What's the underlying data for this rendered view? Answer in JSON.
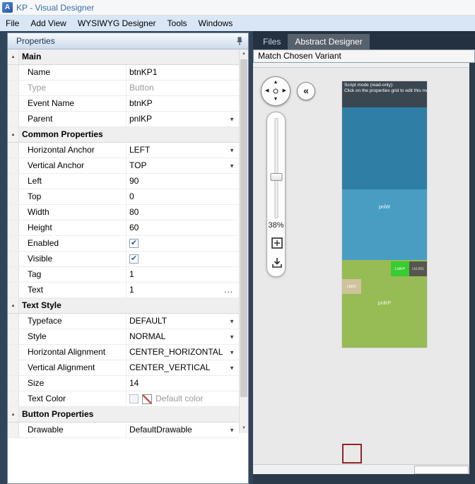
{
  "window": {
    "title": "KP - Visual Designer",
    "logo_letter": "A"
  },
  "menu": {
    "items": [
      "File",
      "Add View",
      "WYSIWYG Designer",
      "Tools",
      "Windows"
    ]
  },
  "properties_panel": {
    "title": "Properties",
    "sections": [
      {
        "label": "Main",
        "rows": [
          {
            "name": "Name",
            "value": "btnKP1",
            "type": "text"
          },
          {
            "name": "Type",
            "value": "Button",
            "type": "disabled"
          },
          {
            "name": "Event Name",
            "value": "btnKP",
            "type": "text"
          },
          {
            "name": "Parent",
            "value": "pnlKP",
            "type": "dropdown"
          }
        ]
      },
      {
        "label": "Common Properties",
        "rows": [
          {
            "name": "Horizontal Anchor",
            "value": "LEFT",
            "type": "dropdown"
          },
          {
            "name": "Vertical Anchor",
            "value": "TOP",
            "type": "dropdown"
          },
          {
            "name": "Left",
            "value": "90",
            "type": "text"
          },
          {
            "name": "Top",
            "value": "0",
            "type": "text"
          },
          {
            "name": "Width",
            "value": "80",
            "type": "text"
          },
          {
            "name": "Height",
            "value": "60",
            "type": "text"
          },
          {
            "name": "Enabled",
            "value": "",
            "type": "checkbox",
            "checked": true
          },
          {
            "name": "Visible",
            "value": "",
            "type": "checkbox",
            "checked": true
          },
          {
            "name": "Tag",
            "value": "1",
            "type": "text"
          },
          {
            "name": "Text",
            "value": "1",
            "type": "ellipsis"
          }
        ]
      },
      {
        "label": "Text Style",
        "rows": [
          {
            "name": "Typeface",
            "value": "DEFAULT",
            "type": "dropdown"
          },
          {
            "name": "Style",
            "value": "NORMAL",
            "type": "dropdown"
          },
          {
            "name": "Horizontal Alignment",
            "value": "CENTER_HORIZONTAL",
            "type": "dropdown"
          },
          {
            "name": "Vertical Alignment",
            "value": "CENTER_VERTICAL",
            "type": "dropdown"
          },
          {
            "name": "Size",
            "value": "14",
            "type": "text"
          },
          {
            "name": "Text Color",
            "value": "Default color",
            "type": "color"
          }
        ]
      },
      {
        "label": "Button Properties",
        "rows": [
          {
            "name": "Drawable",
            "value": "DefaultDrawable",
            "type": "dropdown"
          }
        ]
      }
    ]
  },
  "right_panel": {
    "tabs": [
      {
        "label": "Files",
        "active": false
      },
      {
        "label": "Abstract Designer",
        "active": true
      }
    ],
    "match_button": "Match Chosen Variant",
    "zoom_value": "38%",
    "preview": {
      "notice_line1": "Script mode (read-only):",
      "notice_line2": "Click on the properties grid to edit this mode",
      "header_color": "#3b4750",
      "panel_top_color": "#2e7ea6",
      "pnlw_label": "pnlW",
      "pnlw_color": "#4a9dc2",
      "pnlkp_label": "pnlKP",
      "pnlkp_color": "#97bb55",
      "buttons": [
        {
          "label": "LblKP",
          "color": "#38cc30",
          "text_color": "#effce8"
        },
        {
          "label": "Lbl.BG",
          "color": "#56564e",
          "text_color": "#d9d9d1"
        },
        {
          "label": "Lbl#1",
          "color": "#cfc39b",
          "text_color": "#ffffff"
        }
      ]
    },
    "colors": {
      "canvas_bg": "#e9e9e9",
      "selection_border": "#8f2626"
    }
  }
}
